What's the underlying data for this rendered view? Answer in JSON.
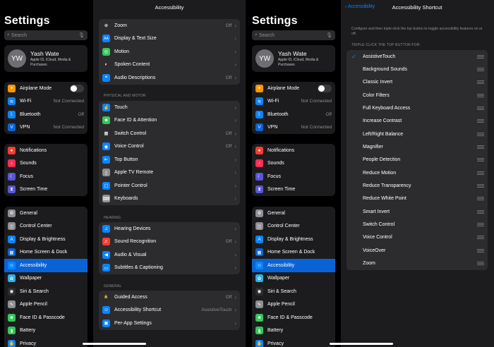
{
  "left": {
    "title": "Settings",
    "search_placeholder": "Search",
    "profile": {
      "initials": "YW",
      "name": "Yash Wate",
      "subtitle": "Apple ID, iCloud, Media & Purchases"
    },
    "group1": [
      {
        "label": "Airplane Mode",
        "value": "",
        "icon": "airplane-icon",
        "color": "#ff9500",
        "glyph": "✈",
        "toggle": true
      },
      {
        "label": "Wi-Fi",
        "value": "Not Connected",
        "icon": "wifi-icon",
        "color": "#0a84ff",
        "glyph": "≋"
      },
      {
        "label": "Bluetooth",
        "value": "Off",
        "icon": "bluetooth-icon",
        "color": "#0a84ff",
        "glyph": "ᛒ"
      },
      {
        "label": "VPN",
        "value": "Not Connected",
        "icon": "vpn-icon",
        "color": "#0a63d6",
        "glyph": "V"
      }
    ],
    "group2": [
      {
        "label": "Notifications",
        "icon": "notifications-icon",
        "color": "#ff3b30",
        "glyph": "●"
      },
      {
        "label": "Sounds",
        "icon": "sounds-icon",
        "color": "#ff2d55",
        "glyph": "♪"
      },
      {
        "label": "Focus",
        "icon": "focus-icon",
        "color": "#5856d6",
        "glyph": "☾"
      },
      {
        "label": "Screen Time",
        "icon": "screen-time-icon",
        "color": "#5856d6",
        "glyph": "⧗"
      }
    ],
    "group3": [
      {
        "label": "General",
        "icon": "gear-icon",
        "color": "#8e8e93",
        "glyph": "⚙"
      },
      {
        "label": "Control Center",
        "icon": "control-center-icon",
        "color": "#8e8e93",
        "glyph": "◫"
      },
      {
        "label": "Display & Brightness",
        "icon": "display-icon",
        "color": "#0a84ff",
        "glyph": "A"
      },
      {
        "label": "Home Screen & Dock",
        "icon": "home-screen-icon",
        "color": "#0a63d6",
        "glyph": "▦"
      },
      {
        "label": "Accessibility",
        "icon": "accessibility-icon",
        "color": "#0a84ff",
        "glyph": "☺"
      },
      {
        "label": "Wallpaper",
        "icon": "wallpaper-icon",
        "color": "#32ade6",
        "glyph": "✿"
      },
      {
        "label": "Siri & Search",
        "icon": "siri-icon",
        "color": "#2c2c2e",
        "glyph": "◉"
      },
      {
        "label": "Apple Pencil",
        "icon": "pencil-icon",
        "color": "#8e8e93",
        "glyph": "✎"
      },
      {
        "label": "Face ID & Passcode",
        "icon": "face-id-icon",
        "color": "#34c759",
        "glyph": "☻"
      },
      {
        "label": "Battery",
        "icon": "battery-icon",
        "color": "#34c759",
        "glyph": "▮"
      },
      {
        "label": "Privacy",
        "icon": "privacy-icon",
        "color": "#0a84ff",
        "glyph": "✋"
      }
    ]
  },
  "accessibility": {
    "title": "Accessibility",
    "vision": [
      {
        "label": "Zoom",
        "value": "Off",
        "icon": "zoom-icon",
        "color": "#2c2c2e",
        "glyph": "⊕"
      },
      {
        "label": "Display & Text Size",
        "value": "",
        "icon": "text-size-icon",
        "color": "#0a84ff",
        "glyph": "AA"
      },
      {
        "label": "Motion",
        "value": "",
        "icon": "motion-icon",
        "color": "#34c759",
        "glyph": "◎"
      },
      {
        "label": "Spoken Content",
        "value": "",
        "icon": "spoken-content-icon",
        "color": "#2c2c2e",
        "glyph": "◐"
      },
      {
        "label": "Audio Descriptions",
        "value": "Off",
        "icon": "audio-descriptions-icon",
        "color": "#0a84ff",
        "glyph": "❝"
      }
    ],
    "physical_header": "PHYSICAL AND MOTOR",
    "physical": [
      {
        "label": "Touch",
        "value": "",
        "icon": "touch-icon",
        "color": "#0a84ff",
        "glyph": "☝"
      },
      {
        "label": "Face ID & Attention",
        "value": "",
        "icon": "face-attention-icon",
        "color": "#34c759",
        "glyph": "☻"
      },
      {
        "label": "Switch Control",
        "value": "Off",
        "icon": "switch-control-icon",
        "color": "#2c2c2e",
        "glyph": "▦"
      },
      {
        "label": "Voice Control",
        "value": "Off",
        "icon": "voice-control-icon",
        "color": "#0a84ff",
        "glyph": "◉"
      },
      {
        "label": "Top Button",
        "value": "",
        "icon": "top-button-icon",
        "color": "#0a84ff",
        "glyph": "⇤"
      },
      {
        "label": "Apple TV Remote",
        "value": "",
        "icon": "tv-remote-icon",
        "color": "#8e8e93",
        "glyph": "▯"
      },
      {
        "label": "Pointer Control",
        "value": "",
        "icon": "pointer-icon",
        "color": "#0a84ff",
        "glyph": "▢"
      },
      {
        "label": "Keyboards",
        "value": "",
        "icon": "keyboard-icon",
        "color": "#8e8e93",
        "glyph": "⌨"
      }
    ],
    "hearing_header": "HEARING",
    "hearing": [
      {
        "label": "Hearing Devices",
        "value": "",
        "icon": "hearing-devices-icon",
        "color": "#0a84ff",
        "glyph": "♫"
      },
      {
        "label": "Sound Recognition",
        "value": "Off",
        "icon": "sound-recognition-icon",
        "color": "#ff3b30",
        "glyph": "♬"
      },
      {
        "label": "Audio & Visual",
        "value": "",
        "icon": "audio-visual-icon",
        "color": "#0a84ff",
        "glyph": "◀"
      },
      {
        "label": "Subtitles & Captioning",
        "value": "",
        "icon": "subtitles-icon",
        "color": "#0a84ff",
        "glyph": "▭"
      }
    ],
    "general_header": "GENERAL",
    "general": [
      {
        "label": "Guided Access",
        "value": "Off",
        "icon": "guided-access-icon",
        "color": "#2c2c2e",
        "glyph": "🔒"
      },
      {
        "label": "Accessibility Shortcut",
        "value": "AssistiveTouch",
        "icon": "accessibility-shortcut-icon",
        "color": "#0a84ff",
        "glyph": "☺"
      },
      {
        "label": "Per-App Settings",
        "value": "",
        "icon": "per-app-icon",
        "color": "#0a84ff",
        "glyph": "▣"
      }
    ]
  },
  "shortcut": {
    "back_label": "Accessibility",
    "title": "Accessibility Shortcut",
    "description": "Configure and then triple-click the top button to toggle accessibility features on or off.",
    "section_header": "TRIPLE-CLICK THE TOP BUTTON FOR:",
    "items": [
      {
        "label": "AssistiveTouch",
        "checked": true
      },
      {
        "label": "Background Sounds"
      },
      {
        "label": "Classic Invert"
      },
      {
        "label": "Color Filters"
      },
      {
        "label": "Full Keyboard Access"
      },
      {
        "label": "Increase Contrast"
      },
      {
        "label": "Left/Right Balance"
      },
      {
        "label": "Magnifier"
      },
      {
        "label": "People Detection"
      },
      {
        "label": "Reduce Motion"
      },
      {
        "label": "Reduce Transparency"
      },
      {
        "label": "Reduce White Point"
      },
      {
        "label": "Smart Invert"
      },
      {
        "label": "Switch Control"
      },
      {
        "label": "Voice Control"
      },
      {
        "label": "VoiceOver"
      },
      {
        "label": "Zoom"
      }
    ]
  },
  "check_glyph": "✓",
  "chevron_glyph": "›"
}
